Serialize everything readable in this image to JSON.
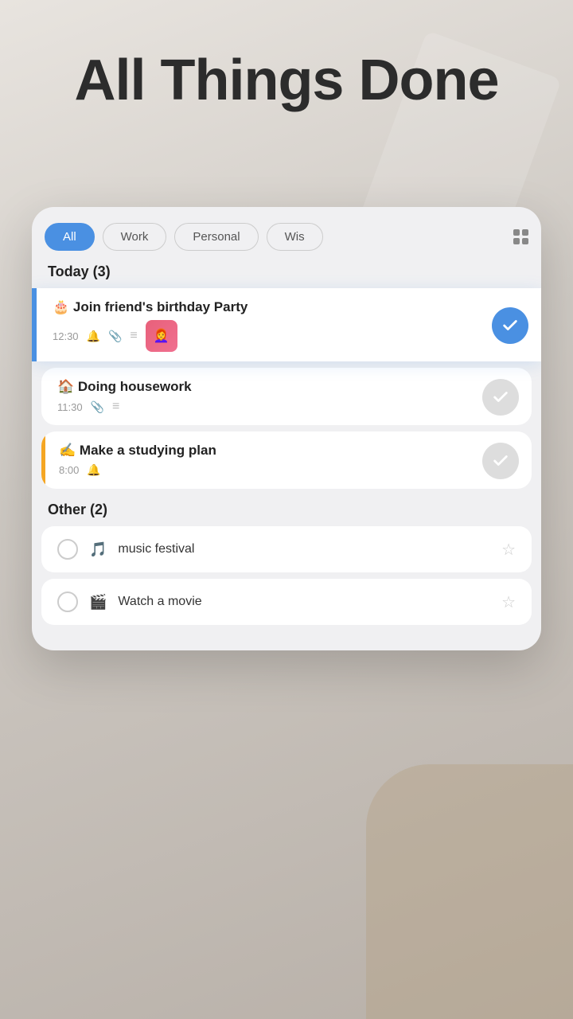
{
  "app": {
    "title": "All Things Done"
  },
  "filters": {
    "tabs": [
      "All",
      "Work",
      "Personal",
      "Wis"
    ],
    "active": "All",
    "grid_icon_label": "grid-view"
  },
  "today_section": {
    "label": "Today (3)",
    "tasks": [
      {
        "id": "task-1",
        "emoji": "🎂",
        "title": "Join friend's birthday Party",
        "time": "12:30",
        "has_bell": true,
        "has_clip": true,
        "has_list": true,
        "has_thumb": true,
        "thumb_emoji": "👩‍🦰",
        "done": true,
        "highlighted": true,
        "border_color": "blue"
      },
      {
        "id": "task-2",
        "emoji": "🏠",
        "title": "Doing housework",
        "time": "11:30",
        "has_bell": false,
        "has_clip": true,
        "has_list": true,
        "done": false,
        "highlighted": false,
        "border_color": "none"
      },
      {
        "id": "task-3",
        "emoji": "✍️",
        "title": "Make a studying plan",
        "time": "8:00",
        "has_bell": true,
        "has_clip": false,
        "has_list": false,
        "done": false,
        "highlighted": false,
        "border_color": "yellow"
      }
    ]
  },
  "other_section": {
    "label": "Other (2)",
    "tasks": [
      {
        "id": "other-1",
        "emoji": "🎵",
        "title": "music festival",
        "done": false,
        "starred": false
      },
      {
        "id": "other-2",
        "emoji": "🎬",
        "title": "Watch a movie",
        "done": false,
        "starred": false
      }
    ]
  },
  "icons": {
    "checkmark": "✓",
    "bell": "🔔",
    "clip": "📎",
    "list": "≡",
    "star_empty": "☆",
    "star_filled": "★"
  }
}
